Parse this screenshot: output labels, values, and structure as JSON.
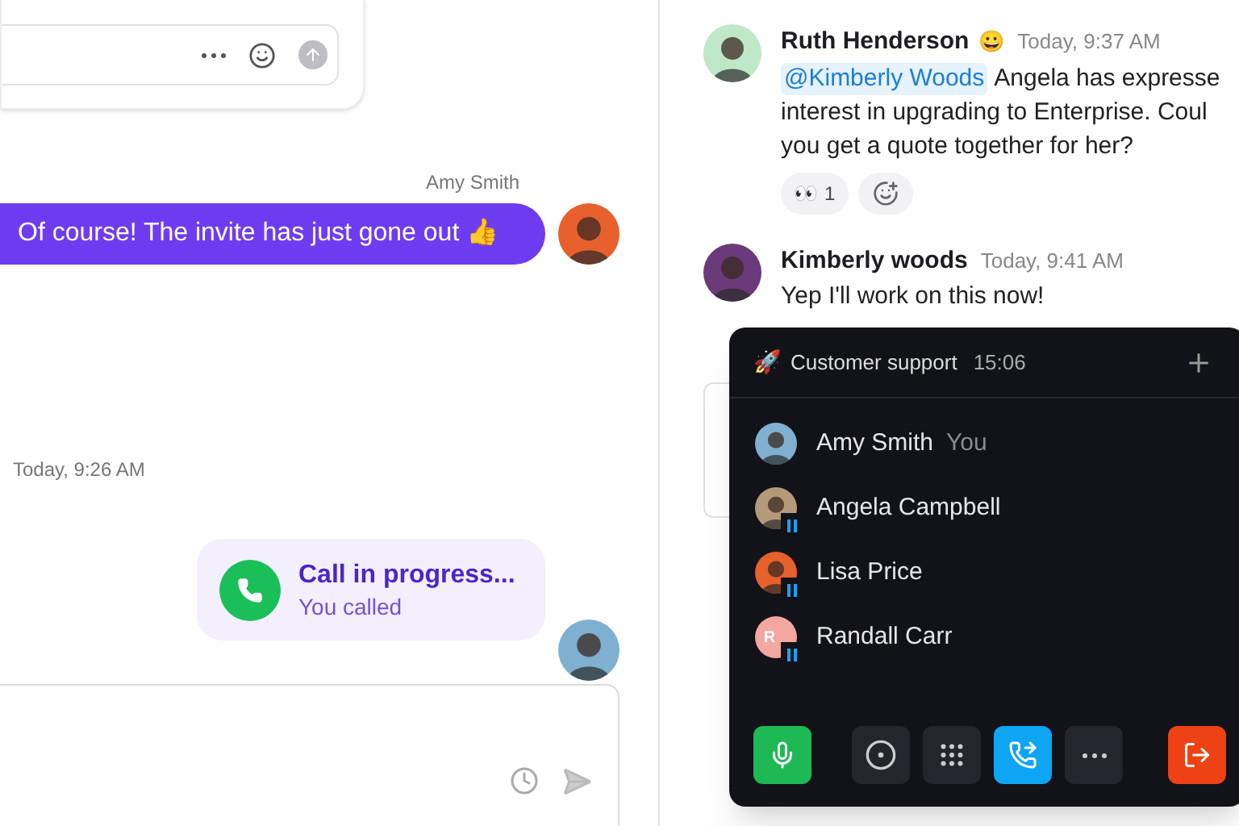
{
  "conversation": [
    {
      "kind": "sender",
      "text": "Amy Smith"
    },
    {
      "kind": "text",
      "text": "Of course! The invite has just gone out 👍"
    },
    {
      "kind": "timestamp",
      "text": "Today, 9:26 AM"
    },
    {
      "kind": "call",
      "title": "Call in progress...",
      "subtitle": "You called"
    }
  ],
  "thread": [
    {
      "name": "Ruth Henderson",
      "status_emoji": "😀",
      "time": "Today, 9:37 AM",
      "mention": "@Kimberly Woods",
      "lines": [
        "Angela has expresse",
        "interest in upgrading to Enterprise. Coul",
        "you get a quote together for her?"
      ],
      "reactions": [
        {
          "emoji": "👀",
          "count": "1"
        }
      ]
    },
    {
      "name": "Kimberly woods",
      "time": "Today, 9:41 AM",
      "lines": [
        "Yep I'll work on this now!"
      ]
    }
  ],
  "call_panel": {
    "emoji": "🚀",
    "title": "Customer support",
    "timer": "15:06",
    "participants": [
      {
        "name": "Amy Smith",
        "tag": "You",
        "on_hold": false
      },
      {
        "name": "Angela Campbell",
        "on_hold": true
      },
      {
        "name": "Lisa Price",
        "on_hold": true
      },
      {
        "name": "Randall Carr",
        "on_hold": true,
        "initials": "R"
      }
    ],
    "controls": [
      {
        "kind": "mic"
      },
      {
        "kind": "record"
      },
      {
        "kind": "keypad"
      },
      {
        "kind": "transfer"
      },
      {
        "kind": "more"
      },
      {
        "kind": "leave"
      }
    ]
  }
}
